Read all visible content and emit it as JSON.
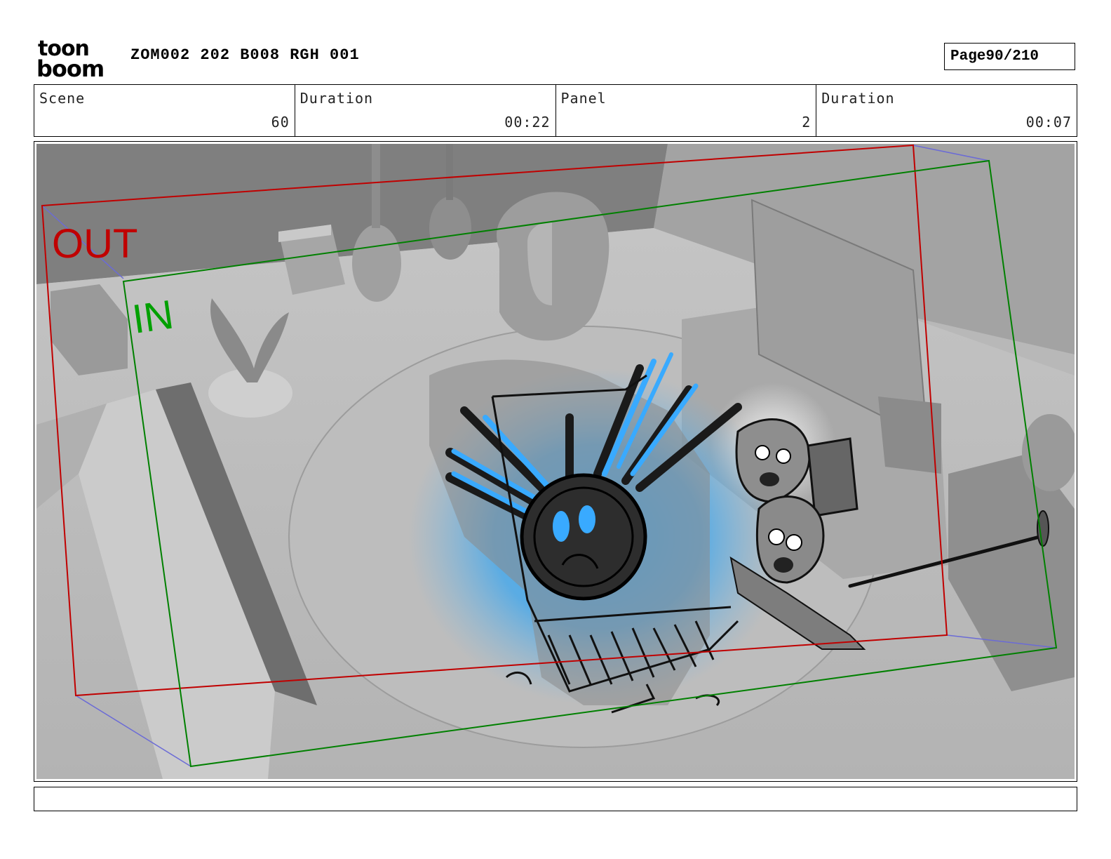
{
  "header": {
    "logo_text_top": "toon",
    "logo_text_bottom": "boom",
    "project_id": "ZOM002 202 B008 RGH 001",
    "page_label": "Page",
    "page_value": "90/210"
  },
  "info": {
    "scene_label": "Scene",
    "scene_value": "60",
    "scene_duration_label": "Duration",
    "scene_duration_value": "00:22",
    "panel_label": "Panel",
    "panel_value": "2",
    "panel_duration_label": "Duration",
    "panel_duration_value": "00:07"
  },
  "panel": {
    "out_label": "OUT",
    "in_label": "IN",
    "out_color": "#c00000",
    "in_color": "#008000",
    "glow_color": "#2ea8ff"
  },
  "notes": {
    "text": ""
  }
}
